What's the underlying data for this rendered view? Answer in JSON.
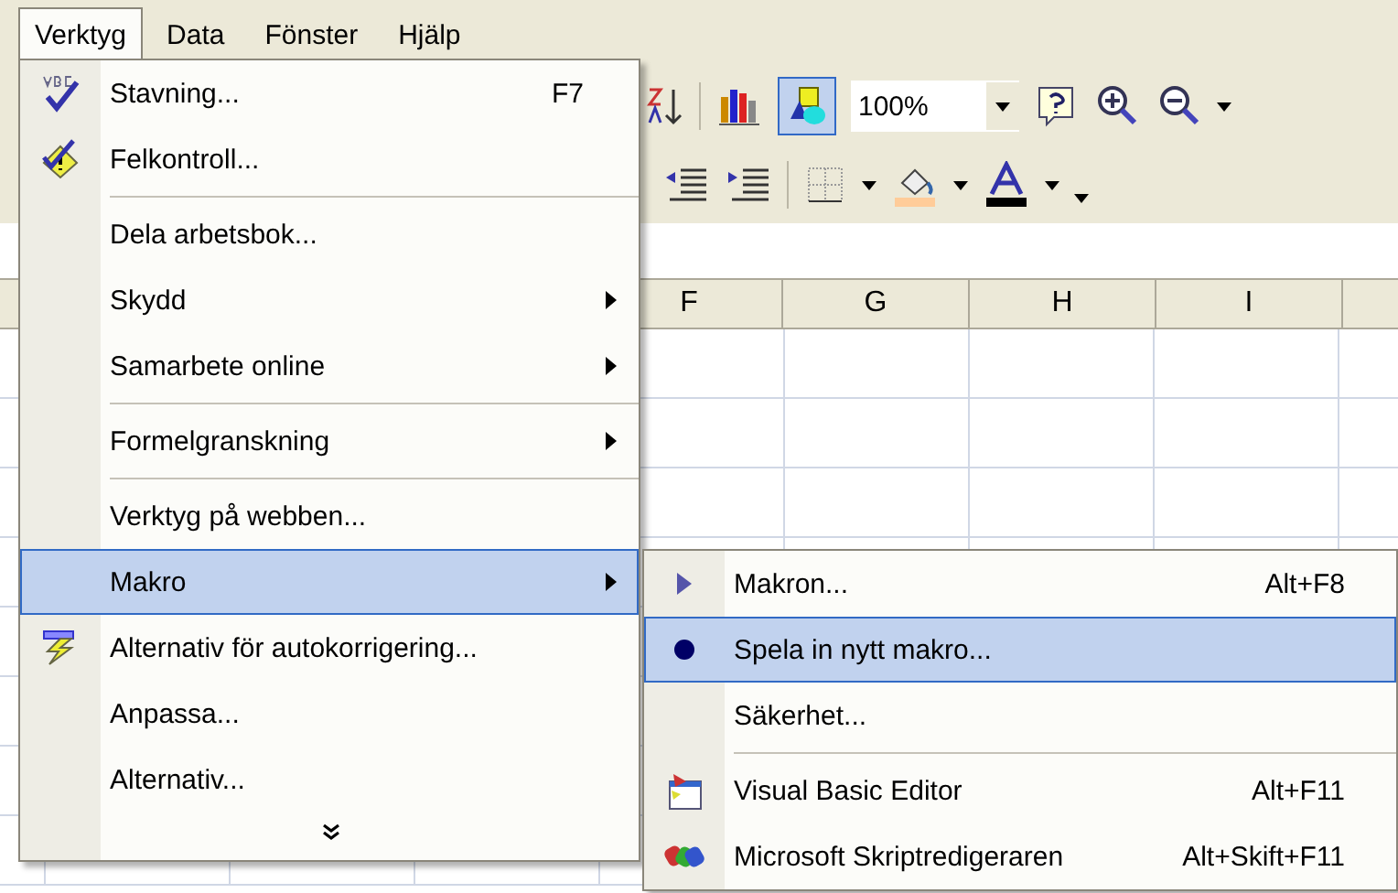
{
  "menubar": [
    {
      "label": "Verktyg",
      "selected": true
    },
    {
      "label": "Data",
      "selected": false
    },
    {
      "label": "Fönster",
      "selected": false
    },
    {
      "label": "Hjälp",
      "selected": false
    }
  ],
  "toolbar": {
    "zoom": "100%",
    "drawing_selected": true
  },
  "columns": [
    "F",
    "G",
    "H",
    "I"
  ],
  "menu": [
    {
      "kind": "item",
      "label": "Stavning...",
      "shortcut": "F7",
      "submenu": false,
      "selected": false
    },
    {
      "kind": "item",
      "label": "Felkontroll...",
      "submenu": false,
      "selected": false
    },
    {
      "kind": "separator"
    },
    {
      "kind": "item",
      "label": "Dela arbetsbok...",
      "submenu": false,
      "selected": false
    },
    {
      "kind": "item",
      "label": "Skydd",
      "submenu": true,
      "selected": false
    },
    {
      "kind": "item",
      "label": "Samarbete online",
      "submenu": true,
      "selected": false
    },
    {
      "kind": "separator"
    },
    {
      "kind": "item",
      "label": "Formelgranskning",
      "submenu": true,
      "selected": false
    },
    {
      "kind": "separator"
    },
    {
      "kind": "item",
      "label": "Verktyg på webben...",
      "submenu": false,
      "selected": false
    },
    {
      "kind": "item",
      "label": "Makro",
      "submenu": true,
      "selected": true
    },
    {
      "kind": "item",
      "label": "Alternativ för autokorrigering...",
      "submenu": false,
      "selected": false
    },
    {
      "kind": "item",
      "label": "Anpassa...",
      "submenu": false,
      "selected": false
    },
    {
      "kind": "item",
      "label": "Alternativ...",
      "submenu": false,
      "selected": false
    },
    {
      "kind": "expand"
    }
  ],
  "submenu": [
    {
      "kind": "item",
      "label": "Makron...",
      "shortcut": "Alt+F8",
      "selected": false
    },
    {
      "kind": "item",
      "label": "Spela in nytt makro...",
      "selected": true
    },
    {
      "kind": "item",
      "label": "Säkerhet...",
      "selected": false
    },
    {
      "kind": "separator"
    },
    {
      "kind": "item",
      "label": "Visual Basic Editor",
      "shortcut": "Alt+F11",
      "selected": false
    },
    {
      "kind": "item",
      "label": "Microsoft Skriptredigeraren",
      "shortcut": "Alt+Skift+F11",
      "selected": false
    }
  ]
}
